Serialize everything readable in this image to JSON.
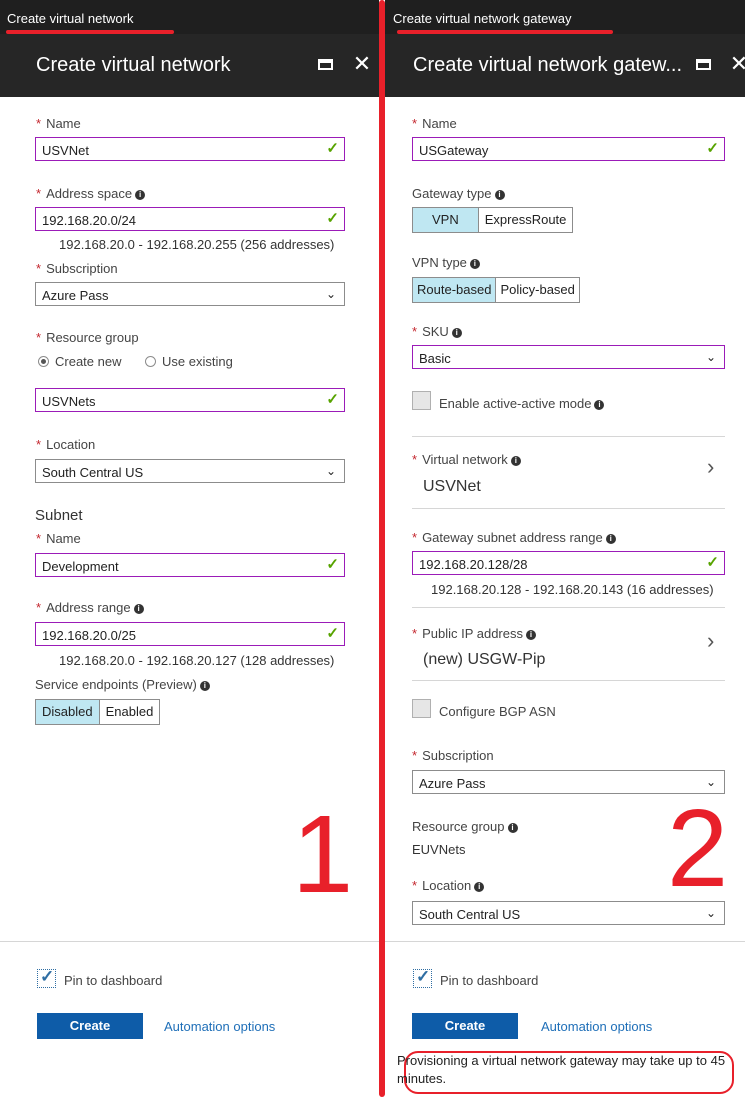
{
  "left": {
    "breadcrumb": "Create virtual network",
    "title": "Create virtual network",
    "name": {
      "label": "Name",
      "value": "USVNet"
    },
    "address_space": {
      "label": "Address space",
      "value": "192.168.20.0/24",
      "hint": "192.168.20.0 - 192.168.20.255 (256 addresses)"
    },
    "subscription": {
      "label": "Subscription",
      "value": "Azure Pass"
    },
    "resource_group": {
      "label": "Resource group",
      "option_new": "Create new",
      "option_existing": "Use existing",
      "value": "USVNets"
    },
    "location": {
      "label": "Location",
      "value": "South Central US"
    },
    "subnet": {
      "title": "Subnet",
      "name_label": "Name",
      "name_value": "Development",
      "range_label": "Address range",
      "range_value": "192.168.20.0/25",
      "range_hint": "192.168.20.0 - 192.168.20.127 (128 addresses)"
    },
    "service_endpoints": {
      "label": "Service endpoints (Preview)",
      "options": [
        "Disabled",
        "Enabled"
      ],
      "selected": "Disabled"
    },
    "step_number": "1",
    "pin_label": "Pin to dashboard",
    "create_label": "Create",
    "automation_label": "Automation options"
  },
  "right": {
    "breadcrumb": "Create virtual network gateway",
    "title": "Create virtual network gatew...",
    "name": {
      "label": "Name",
      "value": "USGateway"
    },
    "gateway_type": {
      "label": "Gateway type",
      "options": [
        "VPN",
        "ExpressRoute"
      ],
      "selected": "VPN"
    },
    "vpn_type": {
      "label": "VPN type",
      "options": [
        "Route-based",
        "Policy-based"
      ],
      "selected": "Route-based"
    },
    "sku": {
      "label": "SKU",
      "value": "Basic"
    },
    "active_active_label": "Enable active-active mode",
    "virtual_network": {
      "label": "Virtual network",
      "value": "USVNet"
    },
    "gateway_subnet": {
      "label": "Gateway subnet address range",
      "value": "192.168.20.128/28",
      "hint": "192.168.20.128 - 192.168.20.143 (16 addresses)"
    },
    "public_ip": {
      "label": "Public IP address",
      "value": "(new) USGW-Pip"
    },
    "bgp_label": "Configure BGP ASN",
    "subscription": {
      "label": "Subscription",
      "value": "Azure Pass"
    },
    "resource_group": {
      "label": "Resource group",
      "value": "EUVNets"
    },
    "location": {
      "label": "Location",
      "value": "South Central US"
    },
    "step_number": "2",
    "pin_label": "Pin to dashboard",
    "create_label": "Create",
    "automation_label": "Automation options",
    "provisioning_note": "Provisioning a virtual network gateway may take up to 45 minutes."
  },
  "colors": {
    "header_bg": "#262626",
    "breadcrumb_bg": "#1f1f1f",
    "field_border_active": "#9b1bb8",
    "required_star": "#c4262e",
    "valid_check": "#57a300",
    "primary_button": "#0e5ca8",
    "segment_active": "#bfe7f2",
    "annotation_red": "#e8202a"
  },
  "icons": {
    "maximize": "maximize-icon",
    "close": "close-icon",
    "info": "info-icon",
    "valid": "check-icon",
    "dropdown": "chevron-down-icon",
    "navigate": "chevron-right-icon"
  }
}
